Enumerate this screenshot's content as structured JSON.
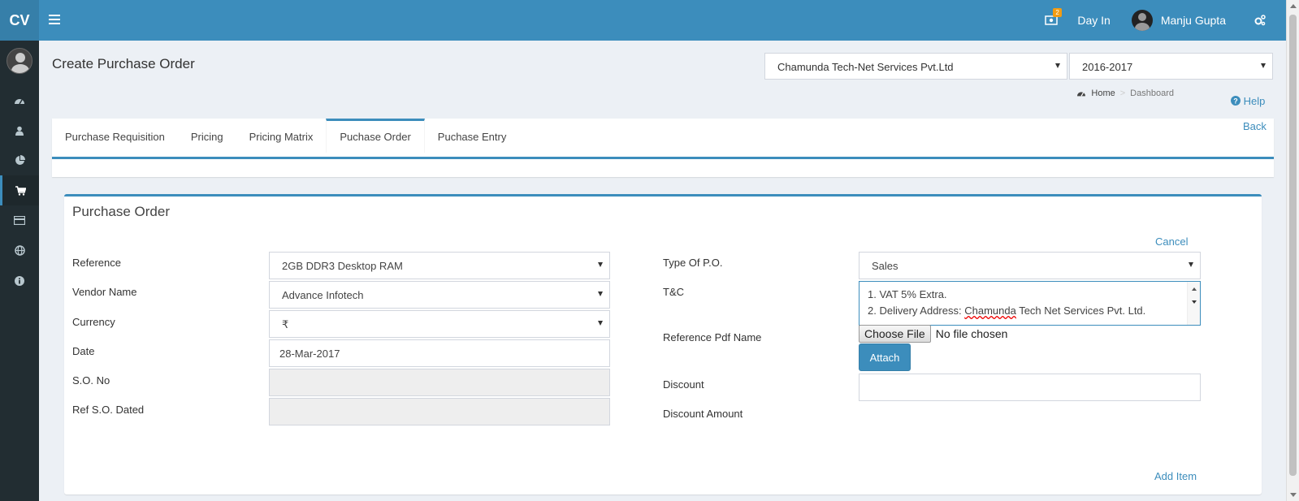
{
  "app": {
    "logo": "CV"
  },
  "header": {
    "notif_count": "2",
    "day_in": "Day In",
    "user_name": "Manju Gupta"
  },
  "sidebar": {
    "items": [
      {
        "icon": "dashboard-icon"
      },
      {
        "icon": "user-icon"
      },
      {
        "icon": "pie-chart-icon"
      },
      {
        "icon": "cart-icon"
      },
      {
        "icon": "credit-card-icon"
      },
      {
        "icon": "globe-icon"
      },
      {
        "icon": "info-icon"
      }
    ]
  },
  "page": {
    "title": "Create Purchase Order",
    "company": "Chamunda Tech-Net Services Pvt.Ltd",
    "year": "2016-2017",
    "breadcrumb_home": "Home",
    "breadcrumb_current": "Dashboard",
    "help": "Help",
    "back": "Back"
  },
  "tabs": [
    "Purchase Requisition",
    "Pricing",
    "Pricing Matrix",
    "Puchase Order",
    "Puchase Entry"
  ],
  "form": {
    "title": "Purchase Order",
    "cancel": "Cancel",
    "add_item": "Add Item",
    "reference_label": "Reference",
    "reference_value": "2GB DDR3 Desktop RAM",
    "vendor_label": "Vendor Name",
    "vendor_value": "Advance Infotech",
    "currency_label": "Currency",
    "currency_value": "₹",
    "date_label": "Date",
    "date_value": "28-Mar-2017",
    "so_label": "S.O. No",
    "so_value": "",
    "refso_label": "Ref S.O. Dated",
    "refso_value": "",
    "type_label": "Type Of P.O.",
    "type_value": "Sales",
    "tc_label": "T&C",
    "tc_line1": "1. VAT 5% Extra.",
    "tc_line2_prefix": "2. Delivery Address: ",
    "tc_line2_word": "Chamunda",
    "tc_line2_suffix": " Tech Net Services Pvt. Ltd.",
    "pdf_label": "Reference Pdf Name",
    "choose_file": "Choose File",
    "no_file": "No file chosen",
    "attach": "Attach",
    "discount_label": "Discount",
    "discount_value": "",
    "discount_amount_label": "Discount Amount"
  },
  "colors": {
    "primary": "#3c8dbc",
    "sidebar": "#222d32",
    "logo_bg": "#367fa9"
  }
}
